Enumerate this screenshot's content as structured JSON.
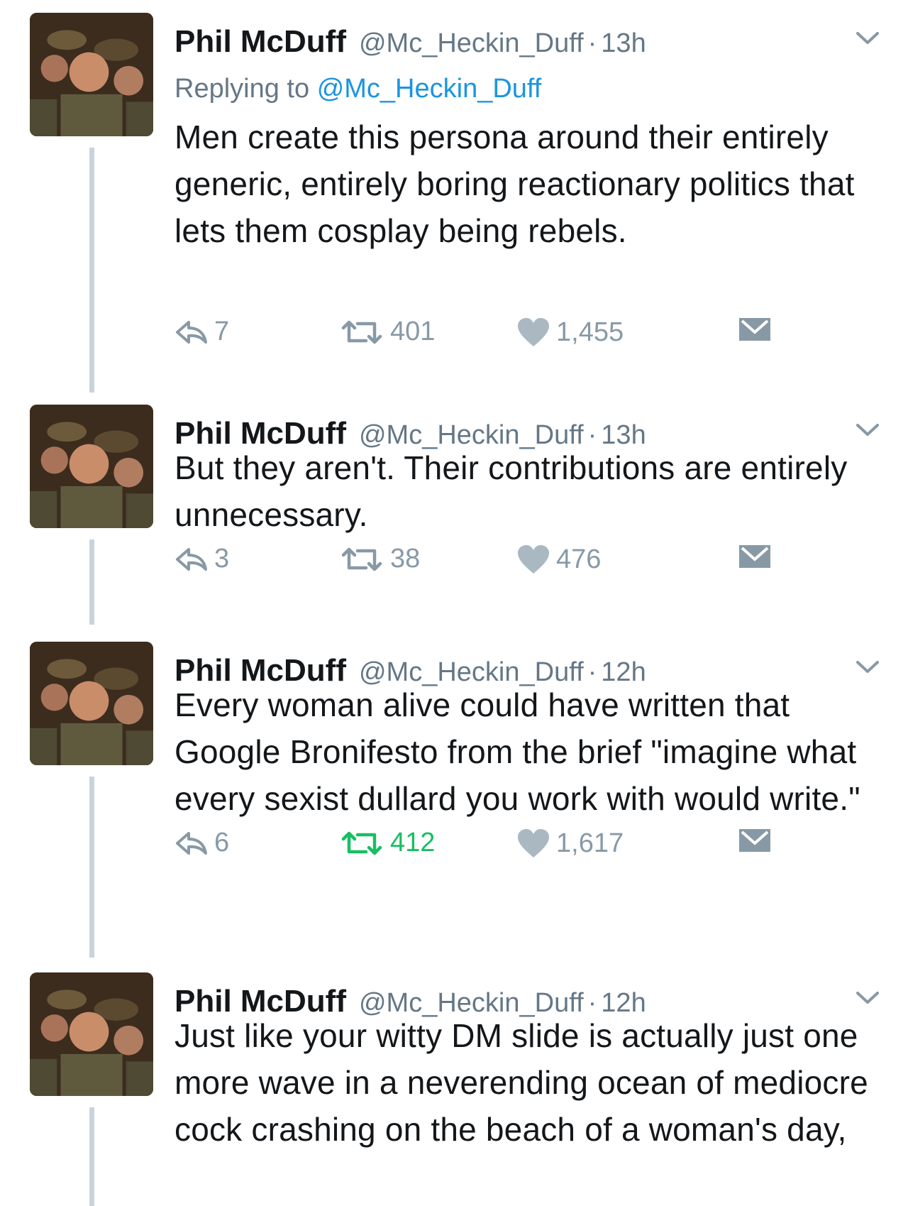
{
  "tweets": [
    {
      "name": "Phil McDuff",
      "handle": "@Mc_Heckin_Duff",
      "dot": "·",
      "time": "13h",
      "replying_prefix": "Replying to",
      "replying_to": "@Mc_Heckin_Duff",
      "text": "Men create this persona around their entirely generic, entirely boring reactionary politics that lets them cosplay being rebels.",
      "replies": "7",
      "retweets": "401",
      "likes": "1,455",
      "retweeted": false
    },
    {
      "name": "Phil McDuff",
      "handle": "@Mc_Heckin_Duff",
      "dot": "·",
      "time": "13h",
      "text": "But they aren't. Their contributions are entirely unnecessary.",
      "replies": "3",
      "retweets": "38",
      "likes": "476",
      "retweeted": false
    },
    {
      "name": "Phil McDuff",
      "handle": "@Mc_Heckin_Duff",
      "dot": "·",
      "time": "12h",
      "text": "Every woman alive could have written that Google Bronifesto from the brief \"imagine what every sexist dullard you work with would write.\"",
      "replies": "6",
      "retweets": "412",
      "likes": "1,617",
      "retweeted": true
    },
    {
      "name": "Phil McDuff",
      "handle": "@Mc_Heckin_Duff",
      "dot": "·",
      "time": "12h",
      "text": "Just like your witty DM slide is actually just one more wave in a neverending ocean of mediocre cock crashing on the beach of a woman's day,"
    }
  ],
  "colors": {
    "text": "#14171a",
    "muted": "#657786",
    "icon": "#8899a6",
    "mention": "#1b95e0",
    "retweet_active": "#17bf63",
    "thread_line": "#c9d3dc"
  },
  "icons": [
    "reply-icon",
    "retweet-icon",
    "like-icon",
    "direct-message-icon",
    "chevron-down-icon"
  ]
}
